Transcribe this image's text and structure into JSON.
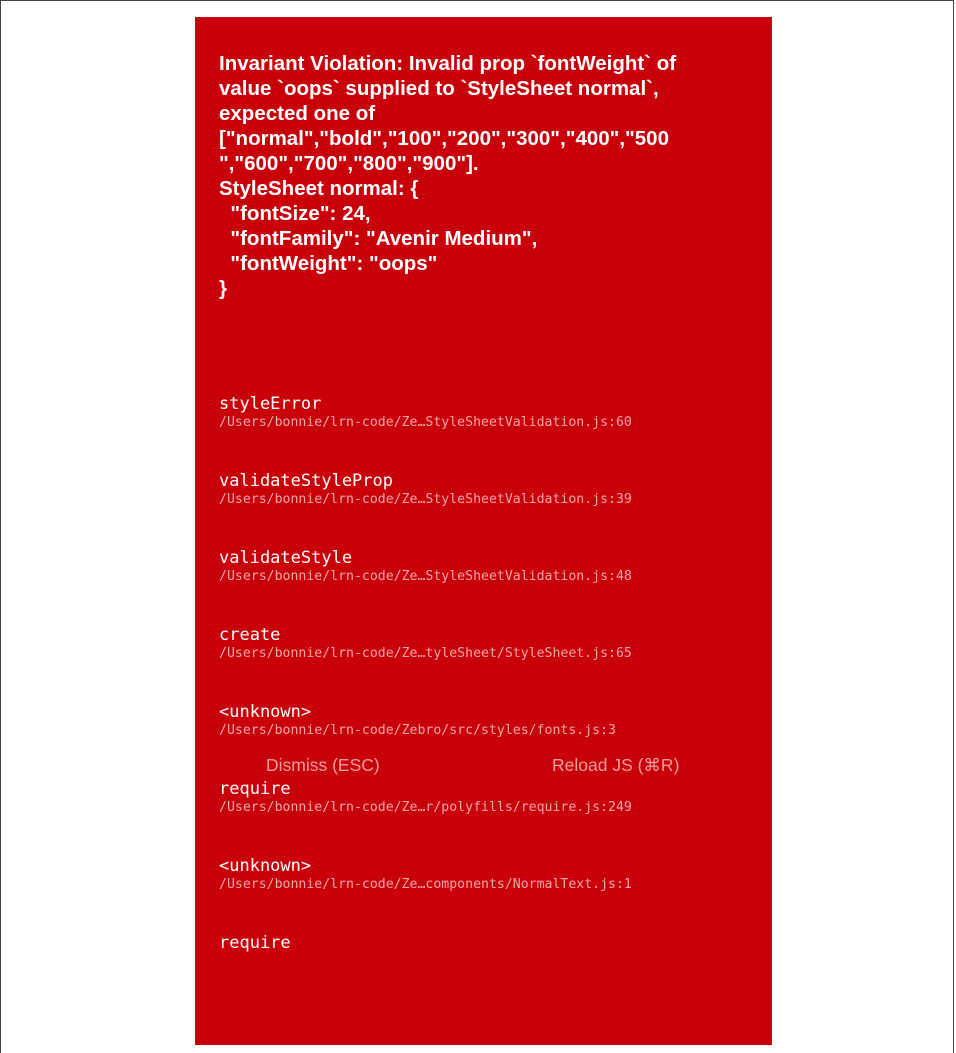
{
  "error": {
    "message": "Invariant Violation: Invalid prop `fontWeight` of\nvalue `oops` supplied to `StyleSheet normal`,\nexpected one of\n[\"normal\",\"bold\",\"100\",\"200\",\"300\",\"400\",\"500\n\",\"600\",\"700\",\"800\",\"900\"].\nStyleSheet normal: {\n  \"fontSize\": 24,\n  \"fontFamily\": \"Avenir Medium\",\n  \"fontWeight\": \"oops\"\n}"
  },
  "stack": [
    {
      "name": "styleError",
      "path": "/Users/bonnie/lrn-code/Ze…StyleSheetValidation.js:60"
    },
    {
      "name": "validateStyleProp",
      "path": "/Users/bonnie/lrn-code/Ze…StyleSheetValidation.js:39"
    },
    {
      "name": "validateStyle",
      "path": "/Users/bonnie/lrn-code/Ze…StyleSheetValidation.js:48"
    },
    {
      "name": "create",
      "path": "/Users/bonnie/lrn-code/Ze…tyleSheet/StyleSheet.js:65"
    },
    {
      "name": "<unknown>",
      "path": "/Users/bonnie/lrn-code/Zebro/src/styles/fonts.js:3"
    },
    {
      "name": "require",
      "path": "/Users/bonnie/lrn-code/Ze…r/polyfills/require.js:249"
    },
    {
      "name": "<unknown>",
      "path": "/Users/bonnie/lrn-code/Ze…components/NormalText.js:1"
    },
    {
      "name": "require",
      "path": ""
    }
  ],
  "buttons": {
    "dismiss": "Dismiss (ESC)",
    "reload": "Reload JS (⌘R)"
  },
  "colors": {
    "background": "#c8000a",
    "message": "#ffffff",
    "path": "#f0a7a7",
    "button": "#ef9e9e"
  }
}
